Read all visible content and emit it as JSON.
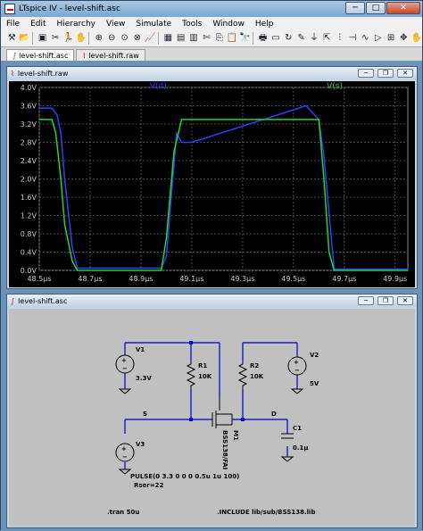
{
  "window": {
    "title": "LTspice IV - level-shift.asc",
    "min": "─",
    "max": "□",
    "close": "✕"
  },
  "menu": [
    "File",
    "Edit",
    "Hierarchy",
    "View",
    "Simulate",
    "Tools",
    "Window",
    "Help"
  ],
  "toolbar_icons": [
    "hammer-icon",
    "open-folder-icon",
    "save-icon",
    "cut-scissors-icon",
    "run-icon",
    "zoom-in-icon",
    "zoom-out-icon",
    "zoom-fit-icon",
    "waveform-icon",
    "tile-icon",
    "cascade-icon",
    "close-window-icon",
    "copy-icon",
    "paste-icon",
    "find-icon",
    "print-icon",
    "text-icon",
    "move-icon",
    "drag-icon",
    "undo-icon",
    "redo-icon",
    "rotate-icon",
    "mirror-icon",
    "wire-icon",
    "ground-icon",
    "label-icon",
    "resistor-icon",
    "capacitor-icon",
    "inductor-icon",
    "diode-icon",
    "component-icon",
    "spice-icon"
  ],
  "tabs": [
    "level-shift.asc",
    "level-shift.raw"
  ],
  "waveform": {
    "title": "level-shift.raw",
    "trace_labels": [
      "V(d)",
      "V(s)"
    ],
    "colors": {
      "vd": "#2f3fff",
      "vs": "#1fd62f",
      "grid": "#4a4a4a",
      "text": "#c8c8c8"
    }
  },
  "chart_data": {
    "type": "line",
    "xlim": [
      48.5,
      49.95
    ],
    "ylim": [
      0.0,
      4.0
    ],
    "x_ticks": [
      "48.5µs",
      "48.7µs",
      "48.9µs",
      "49.1µs",
      "49.3µs",
      "49.5µs",
      "49.7µs",
      "49.9µs"
    ],
    "x_tick_values": [
      48.5,
      48.7,
      48.9,
      49.1,
      49.3,
      49.5,
      49.7,
      49.9
    ],
    "y_ticks": [
      "4.0V",
      "3.6V",
      "3.2V",
      "2.8V",
      "2.4V",
      "2.0V",
      "1.6V",
      "1.2V",
      "0.8V",
      "0.4V",
      "0.0V"
    ],
    "y_tick_values": [
      4.0,
      3.6,
      3.2,
      2.8,
      2.4,
      2.0,
      1.6,
      1.2,
      0.8,
      0.4,
      0.0
    ],
    "series": [
      {
        "name": "V(d)",
        "x": [
          48.5,
          48.55,
          48.57,
          48.585,
          48.6,
          48.63,
          48.65,
          48.98,
          49.0,
          49.04,
          49.06,
          49.1,
          49.55,
          49.6,
          49.62,
          49.66,
          49.95
        ],
        "y": [
          3.55,
          3.55,
          3.4,
          3.0,
          2.0,
          0.5,
          0.05,
          0.05,
          0.3,
          3.0,
          2.8,
          2.8,
          3.6,
          3.3,
          2.5,
          0.03,
          0.03
        ]
      },
      {
        "name": "V(s)",
        "x": [
          48.5,
          48.55,
          48.565,
          48.585,
          48.6,
          48.63,
          48.65,
          48.98,
          49.0,
          49.03,
          49.06,
          49.6,
          49.62,
          49.64,
          49.66,
          49.95
        ],
        "y": [
          3.3,
          3.3,
          3.0,
          2.0,
          1.0,
          0.2,
          0.0,
          0.0,
          0.7,
          2.6,
          3.3,
          3.3,
          2.0,
          0.4,
          0.0,
          0.0
        ]
      }
    ]
  },
  "schematic": {
    "title": "level-shift.asc",
    "labels": {
      "v1": "V1",
      "v1val": "3.3V",
      "r1": "R1",
      "r1val": "10K",
      "r2": "R2",
      "r2val": "10K",
      "v2": "V2",
      "v2val": "5V",
      "s": "S",
      "d": "D",
      "m1": "M1",
      "m1model": "BSS138/FAI",
      "c1": "C1",
      "c1val": "0.1µ",
      "v3": "V3",
      "pulse": "PULSE(0 3.3 0 0 0 0.5u 1u 100)",
      "rser": "Rser=22",
      "tran": ".tran 50u",
      "include": ".INCLUDE lib/sub/BSS138.lib"
    }
  }
}
